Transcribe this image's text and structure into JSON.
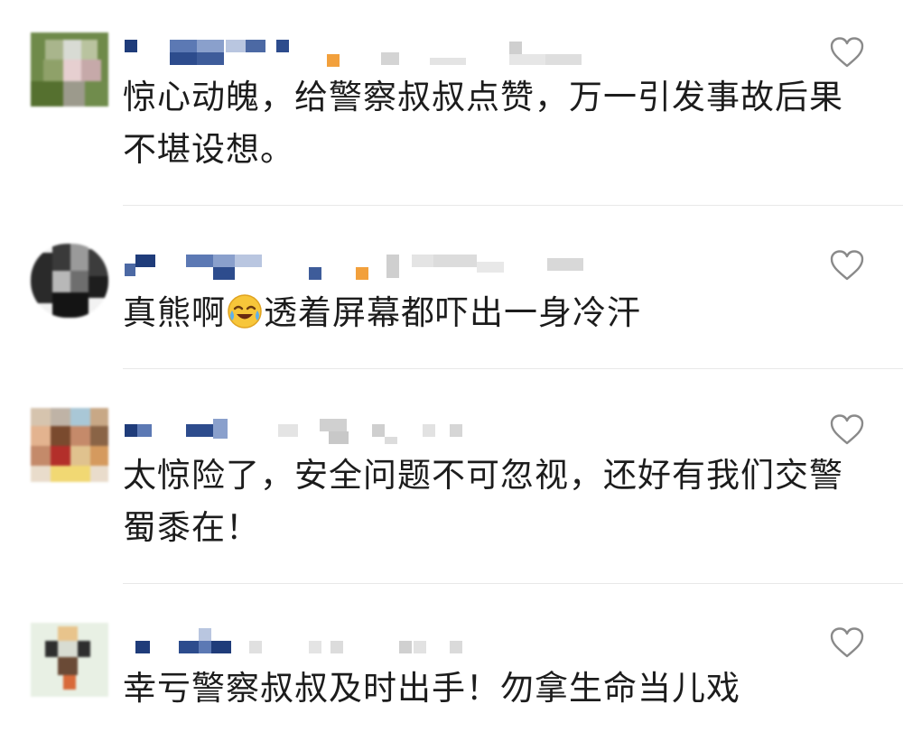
{
  "comments": [
    {
      "text": "惊心动魄，给警察叔叔点赞，万一引发事故后果不堪设想。",
      "like_icon": "heart-outline-icon"
    },
    {
      "text_before_emoji": "真熊啊",
      "emoji": "crying-laughing-emoji",
      "text_after_emoji": "透着屏幕都吓出一身冷汗",
      "like_icon": "heart-outline-icon"
    },
    {
      "text": "太惊险了，安全问题不可忽视，还好有我们交警蜀黍在！",
      "like_icon": "heart-outline-icon"
    },
    {
      "text": "幸亏警察叔叔及时出手！勿拿生命当儿戏",
      "like_icon": "heart-outline-icon"
    }
  ],
  "colors": {
    "text": "#1c1c1c",
    "divider": "#e8e8e8",
    "heart_stroke": "#8a8a8a",
    "name_blue": "#2c4a86",
    "orange_badge": "#f2a03c"
  }
}
